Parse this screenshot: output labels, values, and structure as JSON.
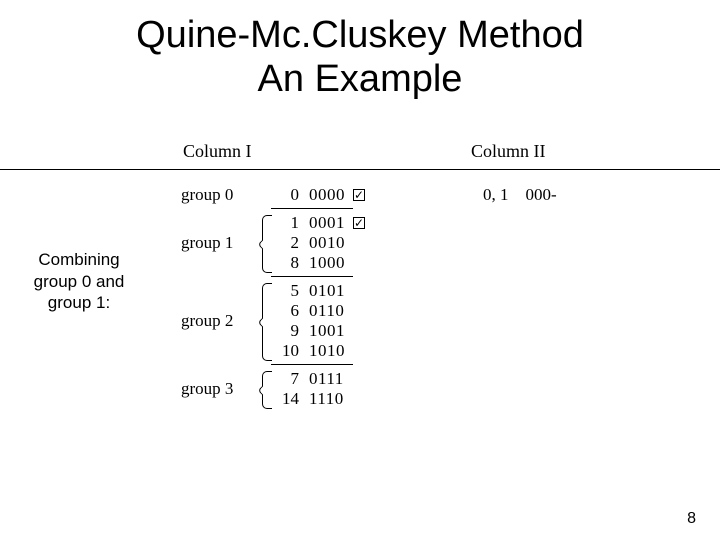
{
  "title_line1": "Quine-Mc.Cluskey Method",
  "title_line2": "An Example",
  "page_number": "8",
  "caption_line1": "Combining",
  "caption_line2": "group 0 and",
  "caption_line3": "group 1:",
  "column1_header": "Column I",
  "column2_header": "Column II",
  "groups": {
    "g0": {
      "label": "group 0",
      "rows": [
        {
          "idx": "0",
          "bin": "0000",
          "checked": true
        }
      ]
    },
    "g1": {
      "label": "group 1",
      "rows": [
        {
          "idx": "1",
          "bin": "0001",
          "checked": true
        },
        {
          "idx": "2",
          "bin": "0010",
          "checked": false
        },
        {
          "idx": "8",
          "bin": "1000",
          "checked": false
        }
      ]
    },
    "g2": {
      "label": "group 2",
      "rows": [
        {
          "idx": "5",
          "bin": "0101",
          "checked": false
        },
        {
          "idx": "6",
          "bin": "0110",
          "checked": false
        },
        {
          "idx": "9",
          "bin": "1001",
          "checked": false
        },
        {
          "idx": "10",
          "bin": "1010",
          "checked": false
        }
      ]
    },
    "g3": {
      "label": "group 3",
      "rows": [
        {
          "idx": "7",
          "bin": "0111",
          "checked": false
        },
        {
          "idx": "14",
          "bin": "1110",
          "checked": false
        }
      ]
    }
  },
  "col2": {
    "combined_idx": "0, 1",
    "combined_bin": "000-"
  },
  "checkmark_glyph": "☑"
}
